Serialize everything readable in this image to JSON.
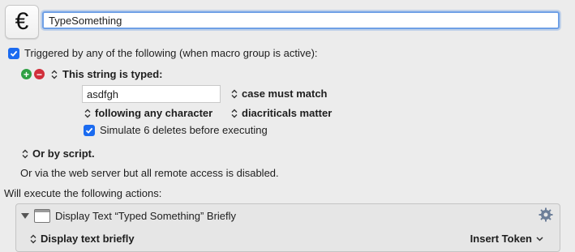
{
  "macro": {
    "icon_glyph": "€",
    "name_value": "TypeSomething"
  },
  "trigger": {
    "header_label": "Triggered by any of the following (when macro group is active):",
    "string_typed_label": "This string is typed:",
    "typed_string_value": "asdfgh",
    "case_option": "case must match",
    "following_option": "following any character",
    "diacriticals_option": "diacriticals matter",
    "simulate_label": "Simulate 6 deletes before executing",
    "or_by_script_label": "Or by script.",
    "web_server_note": "Or via the web server but all remote access is disabled."
  },
  "actions": {
    "header_label": "Will execute the following actions:",
    "action_title": "Display Text “Typed Something” Briefly",
    "display_mode": "Display text briefly",
    "insert_token_label": "Insert Token"
  },
  "colors": {
    "accent": "#1b6bf0",
    "add_green": "#2ea043",
    "remove_red": "#d12f3b",
    "focus_ring": "#6fa0e6"
  },
  "icons": [
    "euro-icon",
    "checkbox-icon",
    "add-icon",
    "remove-icon",
    "updown-icon",
    "disclosure-triangle-icon",
    "window-icon",
    "gear-icon",
    "chevron-down-icon"
  ]
}
